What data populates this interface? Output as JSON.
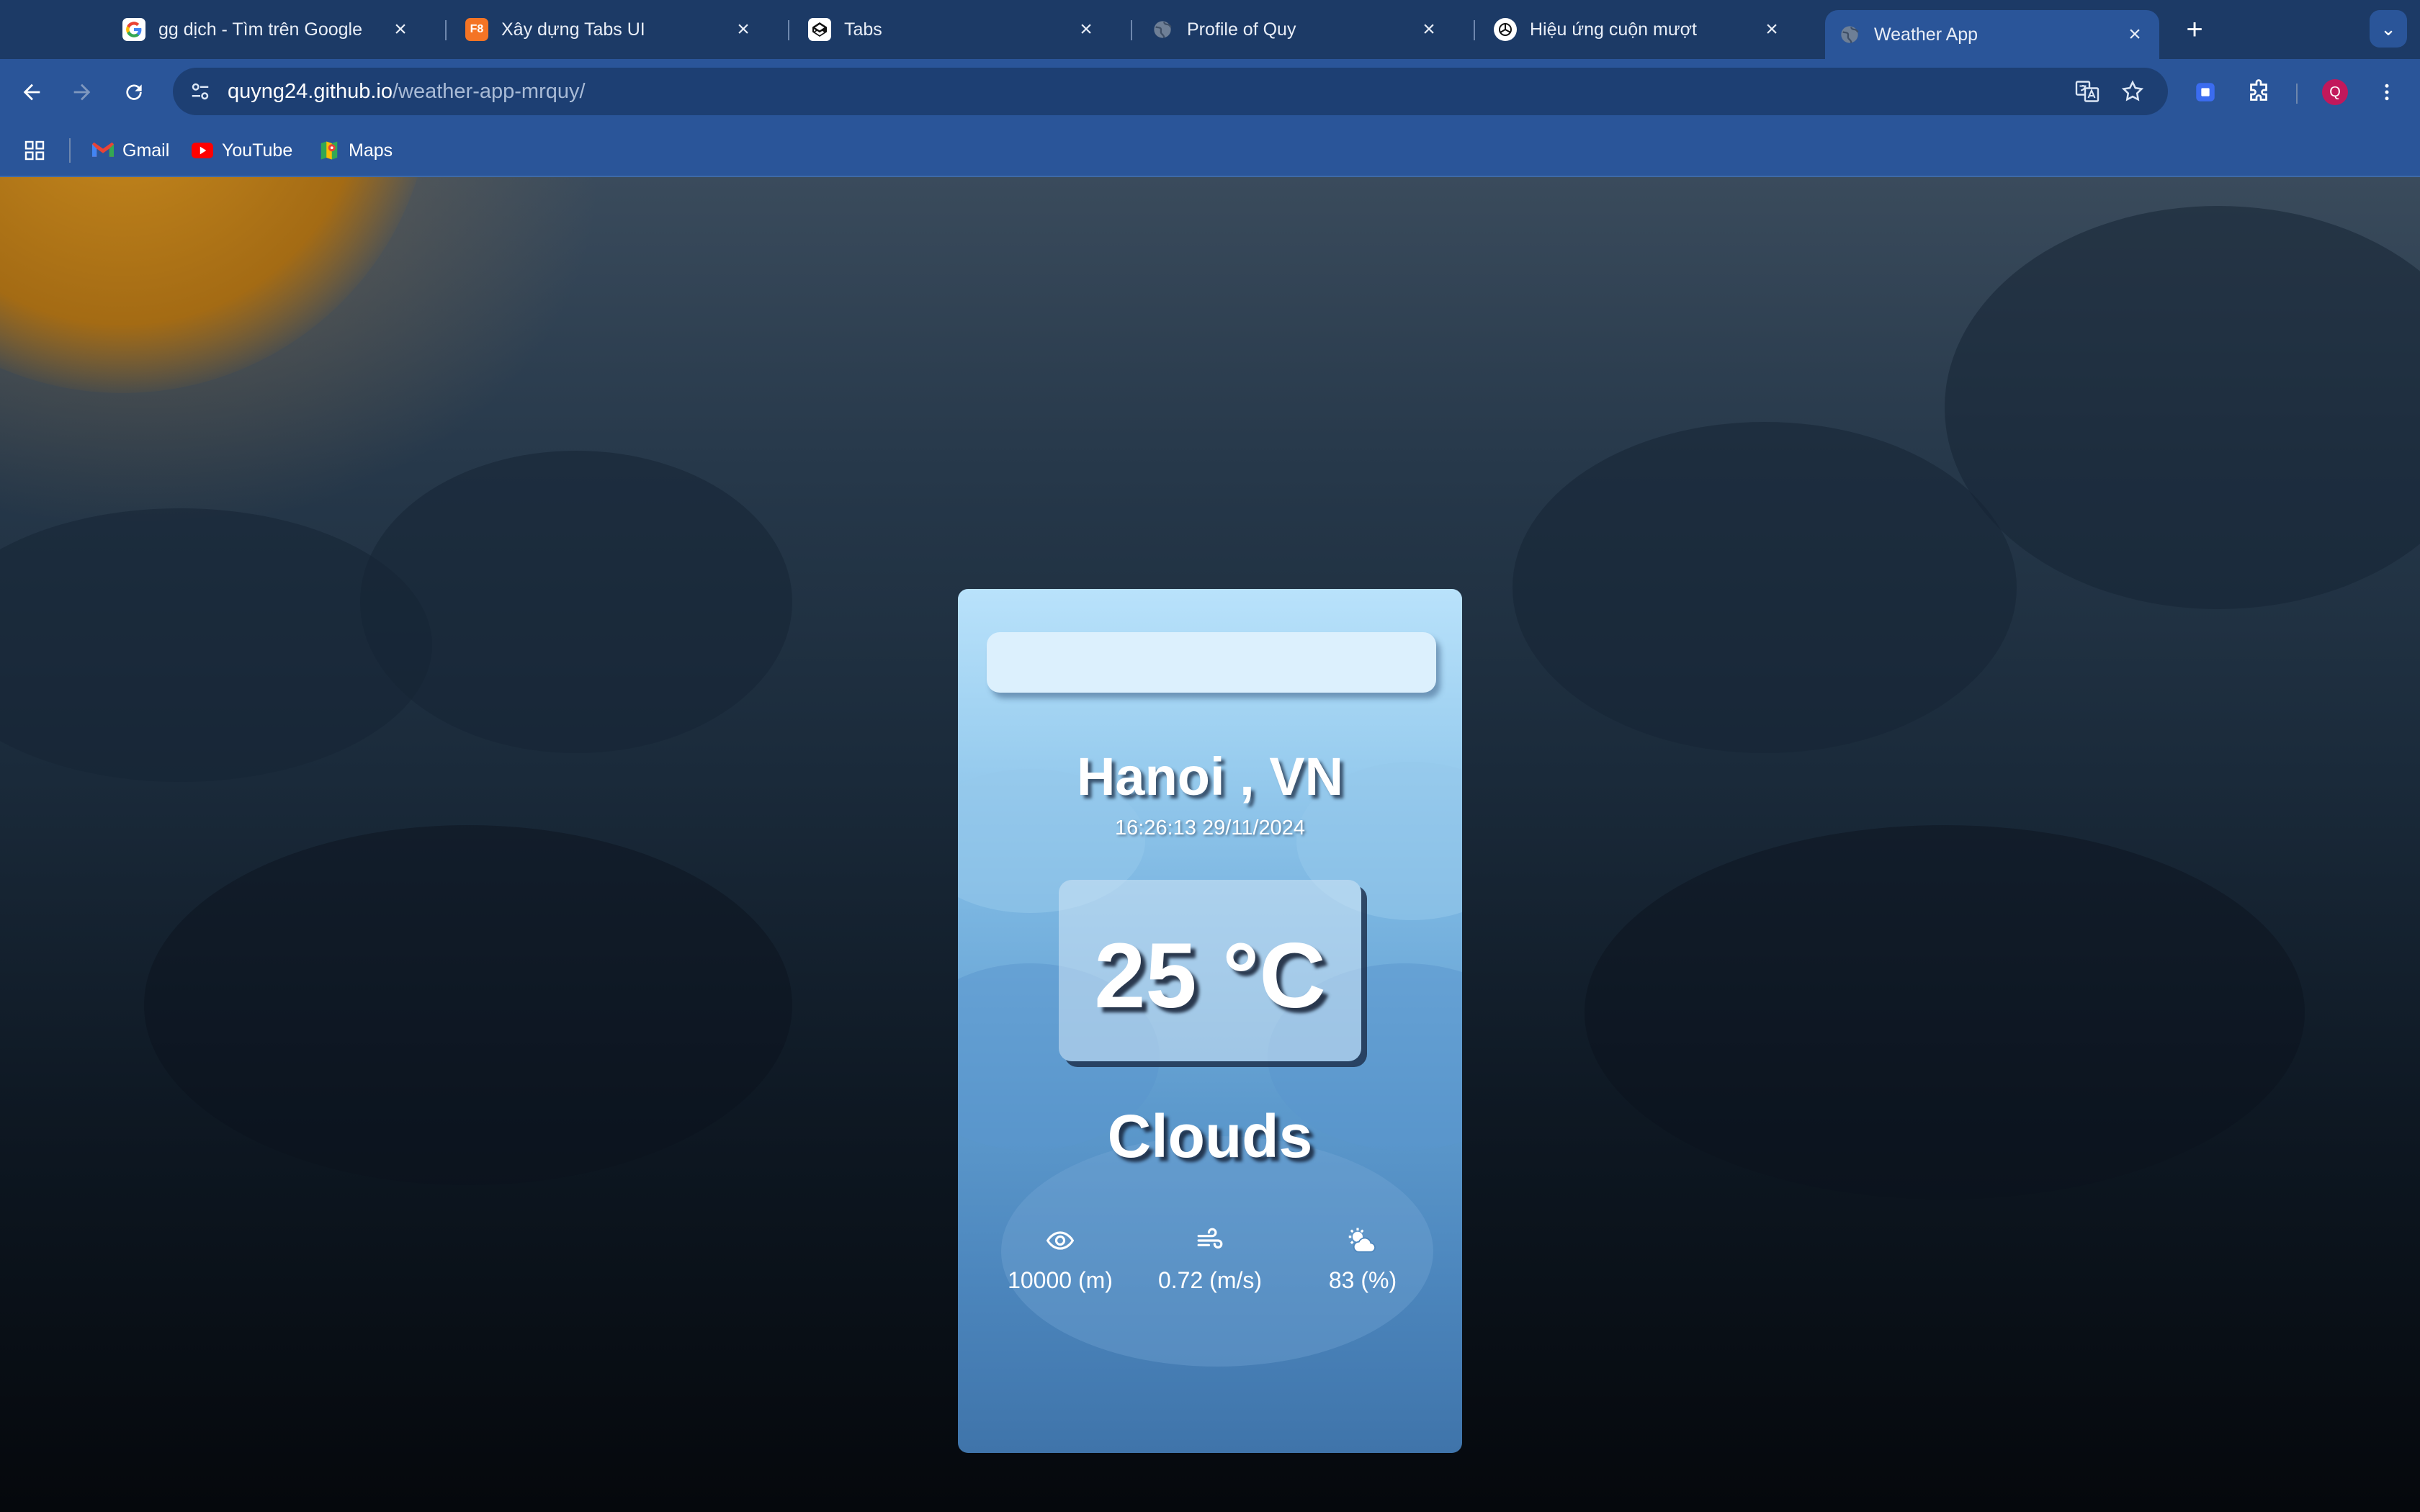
{
  "browser": {
    "tabs": [
      {
        "title": "gg dịch - Tìm trên Google",
        "icon": "google-icon"
      },
      {
        "title": "Xây dựng Tabs UI",
        "icon": "f8-icon",
        "icon_text": "F8"
      },
      {
        "title": "Tabs",
        "icon": "codepen-icon"
      },
      {
        "title": "Profile of Quy",
        "icon": "globe-icon"
      },
      {
        "title": "Hiệu ứng cuộn mượt",
        "icon": "openai-icon"
      },
      {
        "title": "Weather App",
        "icon": "globe-icon",
        "active": true
      }
    ],
    "address": {
      "host": "quyng24.github.io",
      "path": "/weather-app-mrquy/"
    },
    "profile_initial": "Q",
    "bookmarks": [
      {
        "label": "Gmail",
        "icon": "gmail-icon"
      },
      {
        "label": "YouTube",
        "icon": "youtube-icon"
      },
      {
        "label": "Maps",
        "icon": "maps-icon"
      }
    ]
  },
  "weather": {
    "search": {
      "value": "",
      "placeholder": ""
    },
    "city": "Hanoi , VN",
    "datetime": "16:26:13 29/11/2024",
    "temperature": "25 °C",
    "description": "Clouds",
    "stats": [
      {
        "icon": "eye-icon",
        "value": "10000 (m)"
      },
      {
        "icon": "wind-icon",
        "value": "0.72 (m/s)"
      },
      {
        "icon": "sun-cloud-icon",
        "value": "83 (%)"
      }
    ]
  },
  "colors": {
    "tab_bar": "#1c3a66",
    "toolbar": "#2a5599",
    "card_top": "#b9e2fb",
    "card_bottom": "#3f74aa"
  }
}
